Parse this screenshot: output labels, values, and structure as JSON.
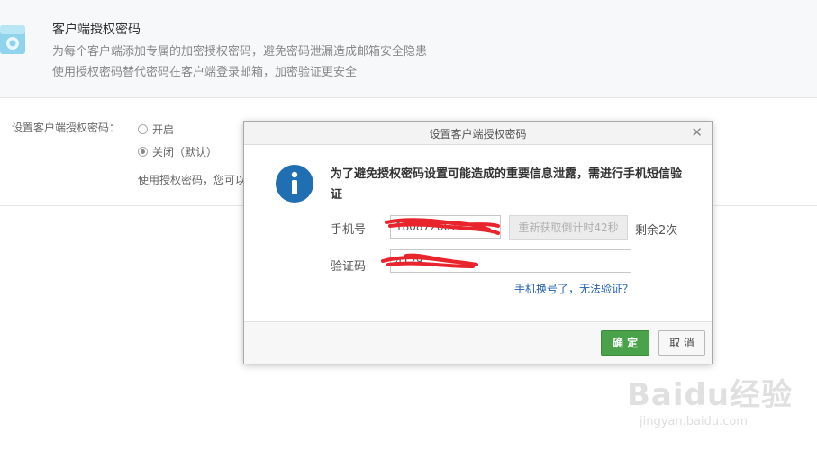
{
  "section": {
    "title": "客户端授权密码",
    "desc1": "为每个客户端添加专属的加密授权密码，避免密码泄漏造成邮箱安全隐患",
    "desc2": "使用授权密码替代密码在客户端登录邮箱，加密验证更安全"
  },
  "setting": {
    "label": "设置客户端授权密码：",
    "option_on": "开启",
    "option_off": "关闭（默认）",
    "selected": "关闭（默认）",
    "note": "使用授权密码，您可以"
  },
  "dialog": {
    "title": "设置客户端授权密码",
    "close_icon": "close-icon",
    "info_icon": "info-icon",
    "warning": "为了避免授权密码设置可能造成的重要信息泄露，需进行手机短信验证",
    "phone_label": "手机号",
    "phone_value": "1808726071",
    "countdown_button": "重新获取倒计时42秒",
    "remaining": "剩余2次",
    "code_label": "验证码",
    "code_value": "4129",
    "help_link": "手机换号了，无法验证？",
    "ok_button": "确 定",
    "cancel_button": "取 消"
  },
  "watermark": {
    "brand": "Baidu经验",
    "url": "jingyan.baidu.com"
  },
  "colors": {
    "ok_green": "#4aa34a",
    "info_blue": "#1f6fb2",
    "link_blue": "#2060b0",
    "scribble_red": "#e8242c"
  }
}
